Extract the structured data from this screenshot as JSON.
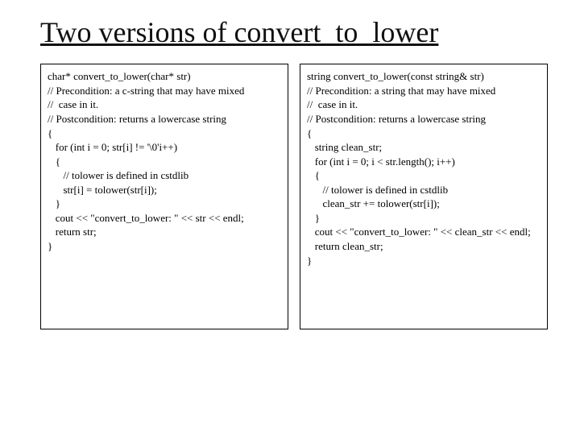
{
  "title": "Two versions of convert_to_lower",
  "left_code": "char* convert_to_lower(char* str)\n// Precondition: a c-string that may have mixed\n//  case in it.\n// Postcondition: returns a lowercase string\n{\n   for (int i = 0; str[i] != '\\0'i++)\n   {\n      // tolower is defined in cstdlib\n      str[i] = tolower(str[i]);\n   }\n   cout << \"convert_to_lower: \" << str << endl;\n   return str;\n}",
  "right_code": "string convert_to_lower(const string& str)\n// Precondition: a string that may have mixed\n//  case in it.\n// Postcondition: returns a lowercase string\n{\n   string clean_str;\n   for (int i = 0; i < str.length(); i++)\n   {\n      // tolower is defined in cstdlib\n      clean_str += tolower(str[i]);\n   }\n   cout << \"convert_to_lower: \" << clean_str << endl;\n   return clean_str;\n}"
}
